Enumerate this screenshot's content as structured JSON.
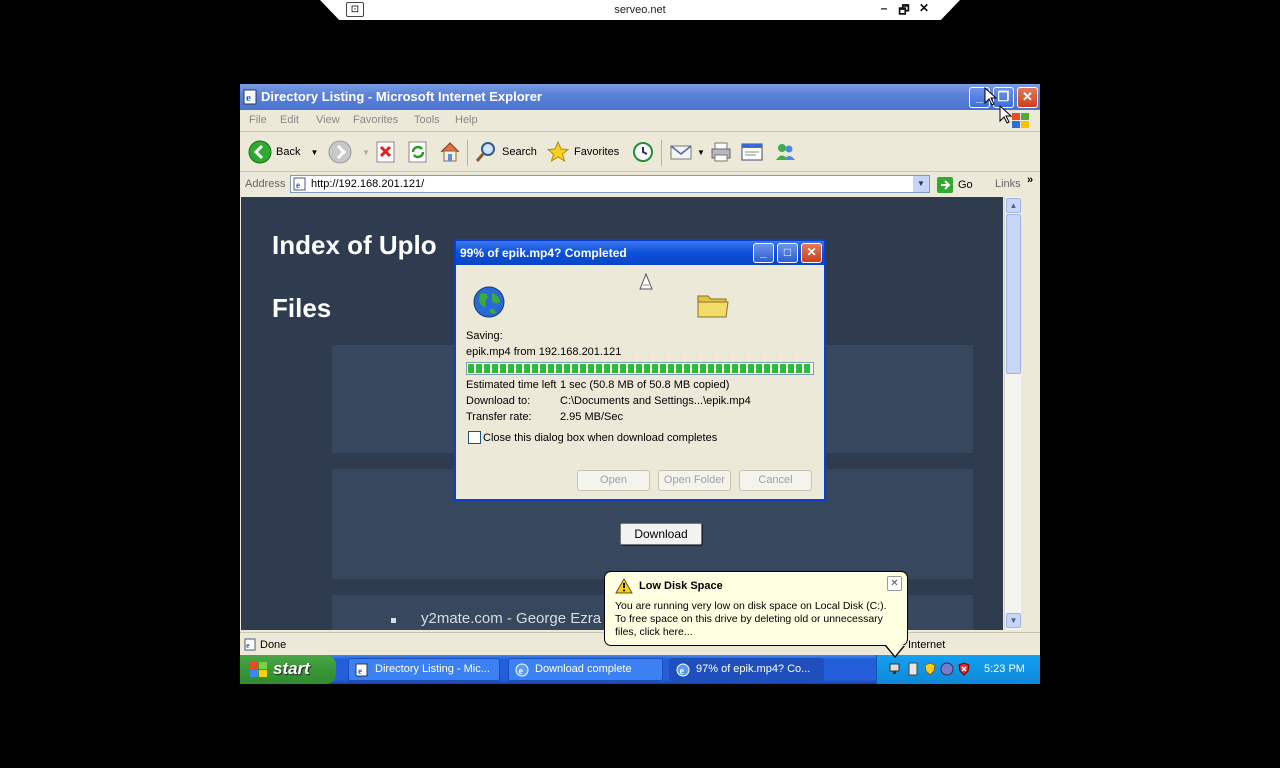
{
  "viewer": {
    "host": "serveo.net",
    "min": "–",
    "restore": "🗗",
    "close": "✕"
  },
  "window": {
    "title": "Directory Listing - Microsoft Internet Explorer"
  },
  "menu": [
    "File",
    "Edit",
    "View",
    "Favorites",
    "Tools",
    "Help"
  ],
  "toolbar": {
    "back": "Back",
    "search": "Search",
    "favorites": "Favorites"
  },
  "address": {
    "label": "Address",
    "url": "http://192.168.201.121/",
    "go": "Go",
    "links": "Links"
  },
  "page": {
    "heading": "Index of Uplo",
    "files_heading": "Files",
    "download_button": "Download",
    "file_item": "y2mate.com - George Ezra"
  },
  "status": {
    "text": "Done",
    "zone": "Internet"
  },
  "dialog": {
    "title": "99% of epik.mp4? Completed",
    "saving_label": "Saving:",
    "saving_value": "epik.mp4 from 192.168.201.121",
    "progress_percent": 99,
    "est_label": "Estimated time left",
    "est_value": "1 sec (50.8 MB of 50.8 MB copied)",
    "dl_to_label": "Download to:",
    "dl_to_value": "C:\\Documents and Settings...\\epik.mp4",
    "rate_label": "Transfer rate:",
    "rate_value": "2.95 MB/Sec",
    "checkbox_label": "Close this dialog box when download completes",
    "checkbox_checked": false,
    "buttons": {
      "open": "Open",
      "open_folder": "Open Folder",
      "cancel": "Cancel"
    }
  },
  "taskbar": {
    "start": "start",
    "tasks": [
      "Directory Listing - Mic...",
      "Download complete",
      "97% of epik.mp4? Co..."
    ],
    "clock": "5:23 PM"
  },
  "balloon": {
    "title": "Low Disk Space",
    "body": "You are running very low on disk space on Local Disk (C:). To free space on this drive by deleting old or unnecessary files, click here..."
  },
  "colors": {
    "titlebar": "#5c82d8",
    "dialog_title": "#0d50d8",
    "taskbar": "#245edb",
    "progress": "#2bbd35",
    "page_bg": "#2f3c4f"
  }
}
